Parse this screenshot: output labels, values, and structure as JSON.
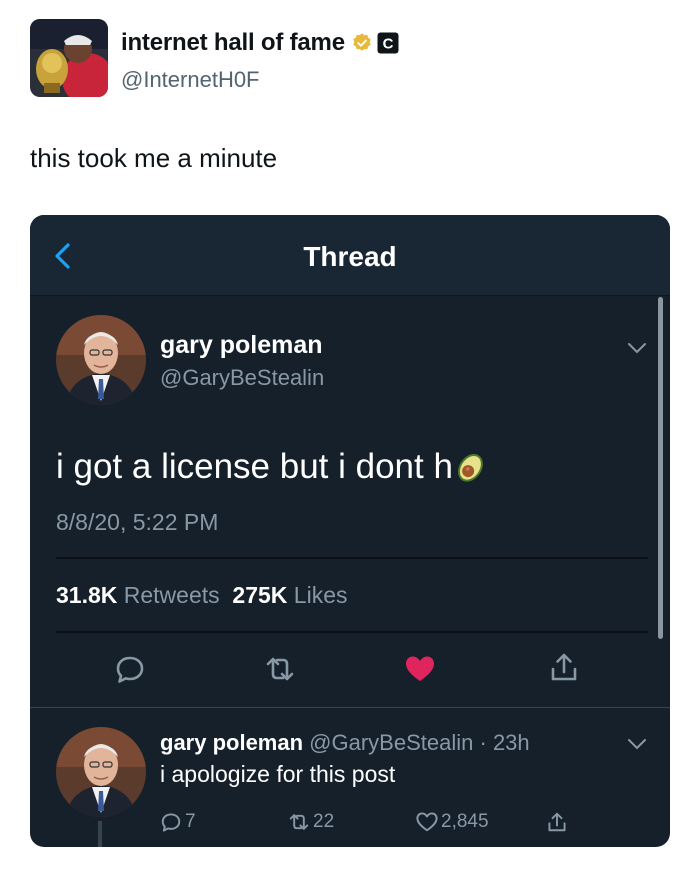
{
  "outer_tweet": {
    "author_name": "internet hall of fame",
    "author_handle": "@InternetH0F",
    "verified_icon": "verified-badge-icon",
    "affiliate_badge": "C",
    "text": "this took me a minute"
  },
  "screenshot": {
    "nav": {
      "title": "Thread",
      "back_icon": "back-chevron-icon"
    },
    "main_tweet": {
      "author_name": "gary poleman",
      "author_handle": "@GaryBeStealin",
      "text": "i got a license but i dont h",
      "emoji": "avocado-emoji",
      "timestamp": "8/8/20, 5:22 PM",
      "retweet_count": "31.8K",
      "retweet_label": "Retweets",
      "like_count": "275K",
      "like_label": "Likes",
      "actions": [
        "reply-icon",
        "retweet-icon",
        "like-icon-filled",
        "share-icon"
      ],
      "like_color": "#e0245e"
    },
    "reply": {
      "author_name": "gary poleman",
      "author_handle": "@GaryBeStealin",
      "separator": "·",
      "time": "23h",
      "text": "i apologize for this post",
      "reply_count": "7",
      "retweet_count": "22",
      "like_count": "2,845"
    }
  },
  "colors": {
    "background_dark": "#15202b",
    "nav_dark": "#192734",
    "secondary_text": "#8899a6",
    "verified_gold": "#e8b93b"
  }
}
